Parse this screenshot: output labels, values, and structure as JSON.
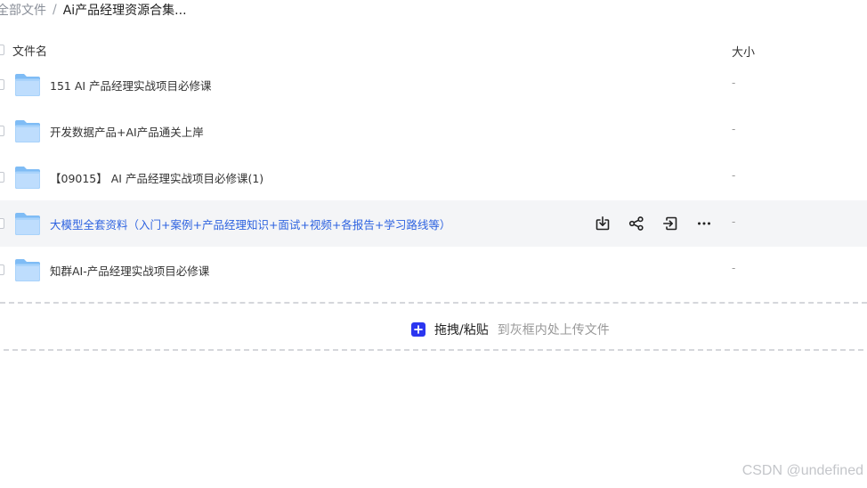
{
  "breadcrumb": {
    "root": "全部文件",
    "separator": "/",
    "current": "Ai产品经理资源合集..."
  },
  "table": {
    "columns": {
      "name": "文件名",
      "size": "大小"
    },
    "rows": [
      {
        "name": "151 AI 产品经理实战项目必修课",
        "size": "-"
      },
      {
        "name": "开发数据产品+AI产品通关上岸",
        "size": "-"
      },
      {
        "name": "【09015】 AI 产品经理实战项目必修课(1)",
        "size": "-"
      },
      {
        "name": "大模型全套资料（入门+案例+产品经理知识+面试+视频+各报告+学习路线等）",
        "size": "-"
      },
      {
        "name": "知群AI-产品经理实战项目必修课",
        "size": "-"
      }
    ],
    "hover_row_index": 3,
    "row_actions": [
      "download-icon",
      "share-icon",
      "move-icon",
      "more-icon"
    ]
  },
  "upload": {
    "label": "拖拽/粘贴",
    "hint": "到灰框内处上传文件"
  },
  "watermark": "CSDN @undefined",
  "colors": {
    "accent": "#2b36f0",
    "link": "#2e63e0",
    "folder_light": "#cfe6ff",
    "folder_dark": "#7fbcf5",
    "hover_bg": "#f4f5f7"
  }
}
